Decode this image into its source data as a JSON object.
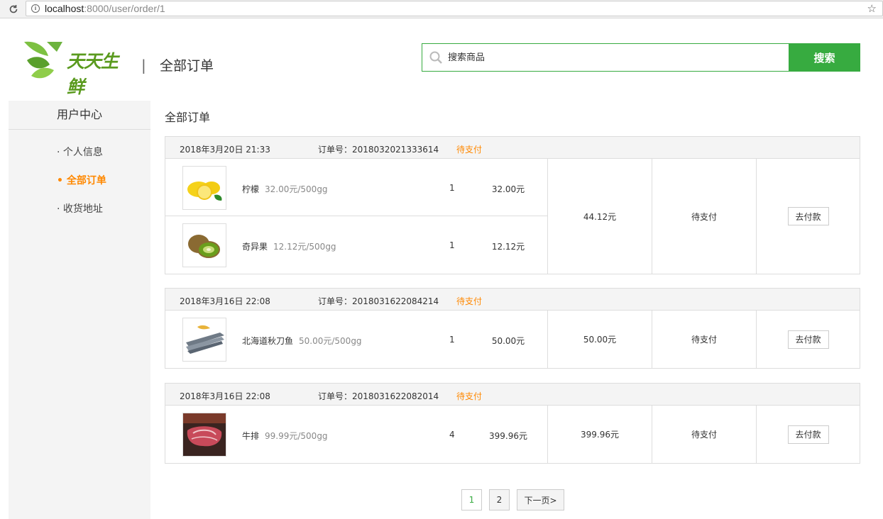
{
  "browser": {
    "url_host": "localhost",
    "url_path": ":8000/user/order/1"
  },
  "header": {
    "logo_text": "天天生鲜",
    "divider": "|",
    "title": "全部订单"
  },
  "search": {
    "placeholder": "搜索商品",
    "button_label": "搜索"
  },
  "sidebar": {
    "title": "用户中心",
    "items": [
      {
        "label": "· 个人信息",
        "active": false
      },
      {
        "label": "• 全部订单",
        "active": true
      },
      {
        "label": "· 收货地址",
        "active": false
      }
    ]
  },
  "main": {
    "title": "全部订单"
  },
  "orders": [
    {
      "date": "2018年3月20日 21:33",
      "order_no": "订单号：2018032021333614",
      "status_head": "待支付",
      "total": "44.12元",
      "status": "待支付",
      "action": "去付款",
      "items": [
        {
          "name": "柠檬",
          "price": "32.00元/500gg",
          "qty": "1",
          "subtotal": "32.00元",
          "image": "lemon"
        },
        {
          "name": "奇异果",
          "price": "12.12元/500gg",
          "qty": "1",
          "subtotal": "12.12元",
          "image": "kiwi"
        }
      ]
    },
    {
      "date": "2018年3月16日 22:08",
      "order_no": "订单号：2018031622084214",
      "status_head": "待支付",
      "total": "50.00元",
      "status": "待支付",
      "action": "去付款",
      "items": [
        {
          "name": "北海道秋刀鱼",
          "price": "50.00元/500gg",
          "qty": "1",
          "subtotal": "50.00元",
          "image": "fish"
        }
      ]
    },
    {
      "date": "2018年3月16日 22:08",
      "order_no": "订单号：2018031622082014",
      "status_head": "待支付",
      "total": "399.96元",
      "status": "待支付",
      "action": "去付款",
      "items": [
        {
          "name": "牛排",
          "price": "99.99元/500gg",
          "qty": "4",
          "subtotal": "399.96元",
          "image": "steak"
        }
      ]
    }
  ],
  "pagination": {
    "pages": [
      "1",
      "2"
    ],
    "current": "1",
    "next_label": "下一页>"
  },
  "colors": {
    "accent": "#37ab40",
    "status": "#ff8800"
  }
}
